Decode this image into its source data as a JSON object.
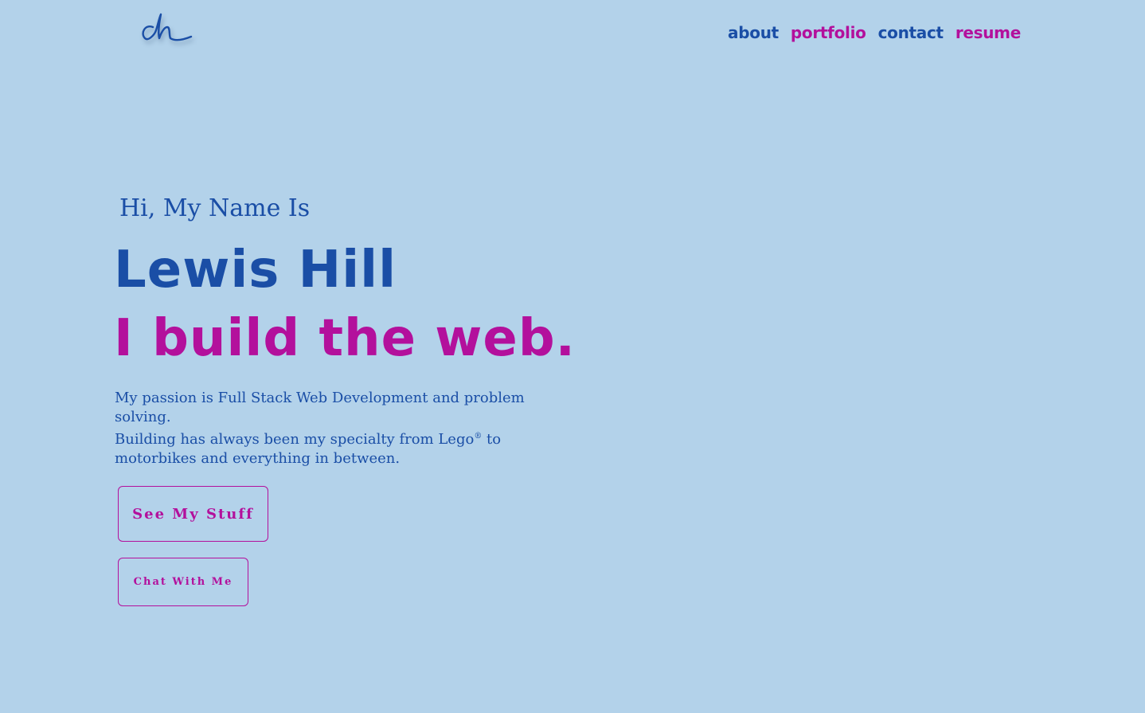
{
  "logo": {
    "text": "dh",
    "icon": "signature-logo"
  },
  "nav": {
    "items": [
      {
        "label": "about",
        "color": "#1a4ea6"
      },
      {
        "label": "portfolio",
        "color": "#b3109c"
      },
      {
        "label": "contact",
        "color": "#1a4ea6"
      },
      {
        "label": "resume",
        "color": "#b3109c"
      }
    ]
  },
  "hero": {
    "greeting": "Hi, My Name Is",
    "name": "Lewis Hill",
    "tagline": "I build the web.",
    "bio_line1": "My passion is Full Stack Web Development and problem solving.",
    "bio_line2_pre": "Building has always been my specialty from Lego",
    "bio_line2_sup": "®",
    "bio_line2_post": " to motorbikes and everything in between."
  },
  "buttons": {
    "primary_label": "See My Stuff",
    "secondary_label": "Chat With Me"
  },
  "colors": {
    "background": "#b3d2ea",
    "primary": "#1a4ea6",
    "accent": "#b3109c"
  }
}
